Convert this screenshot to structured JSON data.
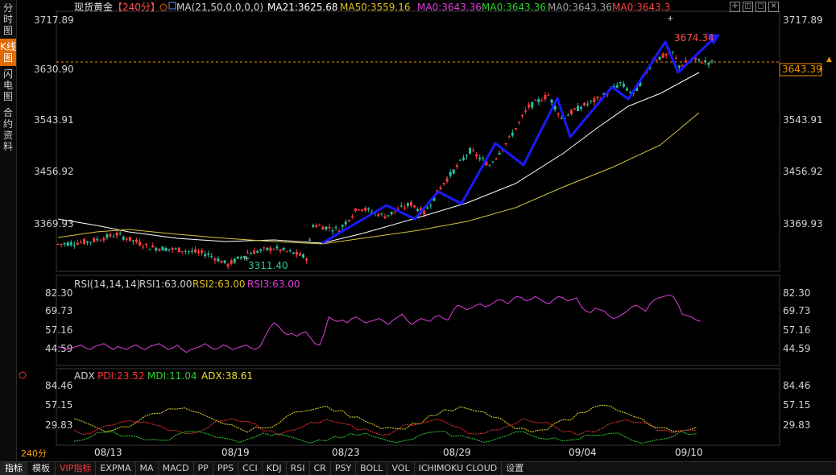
{
  "sidebar": {
    "tabs": [
      {
        "label": "分时图",
        "active": false
      },
      {
        "label": "K线图",
        "active": true
      },
      {
        "label": "闪电图",
        "active": false
      },
      {
        "label": "合约资料",
        "active": false
      }
    ]
  },
  "header": {
    "symbol": "现货黄金",
    "period": "【240分】",
    "ma_label": "MA(21,50,0,0,0,0)",
    "ma21": "MA21:3625.68",
    "ma50": "MA50:3559.16",
    "ma0a": "MA0:3643.36",
    "ma0b": "MA0:3643.36",
    "ma0c": "MA0:3643.36",
    "ma0d": "MA0:3643.3"
  },
  "price_axis": [
    "3717.89",
    "3630.90",
    "3543.91",
    "3456.92",
    "3369.93"
  ],
  "current_price": "3643.39",
  "high_label": "3674.34",
  "low_label": "3311.40",
  "rsi": {
    "label": "RSI(14,14,14)",
    "rsi1": "RSI1:63.00",
    "rsi2": "RSI2:63.00",
    "rsi3": "RSI3:63.00",
    "axis": [
      "82.30",
      "69.73",
      "57.16",
      "44.59"
    ]
  },
  "adx": {
    "label": "ADX",
    "pdi": "PDI:23.52",
    "mdi": "MDI:11.04",
    "adx": "ADX:38.61",
    "axis": [
      "84.46",
      "57.15",
      "29.83"
    ]
  },
  "dates": [
    "08/13",
    "08/19",
    "08/23",
    "08/29",
    "09/04",
    "09/10"
  ],
  "period_label": "240分",
  "bottom_tabs": {
    "indicators": "指标",
    "template": "模板"
  },
  "indicator_tabs": [
    "VIP指标",
    "EXPMA",
    "MA",
    "MACD",
    "PP",
    "PPS",
    "CCI",
    "KDJ",
    "RSI",
    "CR",
    "PSY",
    "BOLL",
    "VOL",
    "ICHIMOKU CLOUD",
    "设置"
  ],
  "colors": {
    "up": "#ff3b3b",
    "down": "#27c2a0",
    "ma21": "#ffffff",
    "ma50": "#d6c43a",
    "arrow": "#1a1aff",
    "rsi": "#e03ee0",
    "pdi": "#ff3030",
    "mdi": "#30d030",
    "adx": "#e8e030",
    "price_line": "#f09000"
  },
  "chart_data": {
    "type": "candlestick",
    "series": [
      {
        "name": "RSI1",
        "values": [
          46,
          45,
          44,
          45,
          46,
          47,
          45,
          44,
          46,
          47,
          48,
          46,
          44,
          46,
          45,
          44,
          46,
          47,
          45,
          44,
          46,
          47,
          48,
          46,
          44,
          45,
          47,
          44,
          42,
          44,
          45,
          46,
          48,
          46,
          44,
          45,
          47,
          46,
          44,
          45,
          46,
          47,
          45,
          44,
          46,
          52,
          58,
          62,
          60,
          56,
          54,
          55,
          53,
          55,
          56,
          52,
          48,
          47,
          55,
          66,
          64,
          63,
          64,
          62,
          65,
          66,
          64,
          62,
          63,
          64,
          65,
          63,
          61,
          64,
          66,
          68,
          64,
          61,
          63,
          65,
          64,
          63,
          66,
          67,
          65,
          64,
          70,
          74,
          73,
          71,
          72,
          74,
          75,
          73,
          74,
          76,
          78,
          77,
          75,
          78,
          80,
          79,
          77,
          78,
          80,
          78,
          76,
          75,
          78,
          80,
          79,
          77,
          78,
          79,
          73,
          70,
          69,
          72,
          71,
          70,
          67,
          65,
          66,
          68,
          70,
          73,
          74,
          72,
          70,
          75,
          78,
          79,
          80,
          81,
          80,
          75,
          68,
          67,
          66,
          64,
          63
        ]
      }
    ],
    "ylim": [
      3290,
      3730
    ]
  }
}
